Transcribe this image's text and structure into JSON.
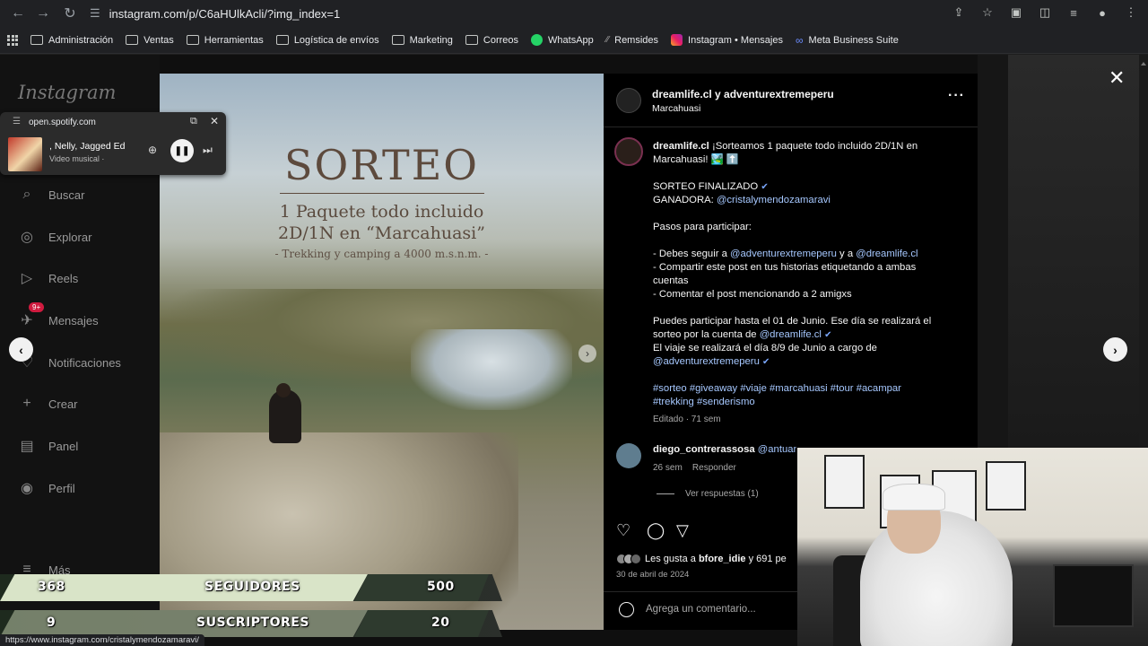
{
  "browser": {
    "url": "instagram.com/p/C6aHUlkAcli/?img_index=1",
    "status_url": "https://www.instagram.com/cristalymendozamaravi/"
  },
  "bookmarks": [
    {
      "label": "Administración",
      "icon": "folder-icon"
    },
    {
      "label": "Ventas",
      "icon": "folder-icon"
    },
    {
      "label": "Herramientas",
      "icon": "folder-icon"
    },
    {
      "label": "Logística de envíos",
      "icon": "folder-icon"
    },
    {
      "label": "Marketing",
      "icon": "folder-icon"
    },
    {
      "label": "Correos",
      "icon": "folder-icon"
    },
    {
      "label": "WhatsApp",
      "icon": "whatsapp-icon"
    },
    {
      "label": "Remsides",
      "icon": "remsides-icon"
    },
    {
      "label": "Instagram • Mensajes",
      "icon": "instagram-icon"
    },
    {
      "label": "Meta Business Suite",
      "icon": "meta-icon"
    }
  ],
  "sidebar": {
    "logo": "Instagram",
    "items": [
      {
        "label": "Buscar",
        "icon": "search-icon"
      },
      {
        "label": "Explorar",
        "icon": "compass-icon"
      },
      {
        "label": "Reels",
        "icon": "reels-icon"
      },
      {
        "label": "Mensajes",
        "icon": "messenger-icon",
        "badge": "9+"
      },
      {
        "label": "Notificaciones",
        "icon": "heart-icon"
      },
      {
        "label": "Crear",
        "icon": "plus-icon"
      },
      {
        "label": "Panel",
        "icon": "dashboard-icon"
      },
      {
        "label": "Perfil",
        "icon": "profile-icon"
      },
      {
        "label": "Más",
        "icon": "menu-icon"
      }
    ]
  },
  "spotify": {
    "url": "open.spotify.com",
    "title": ", Nelly, Jagged Ed",
    "subtitle": "Video musical ·"
  },
  "post_image": {
    "title": "SORTEO",
    "line1": "1 Paquete todo incluido",
    "line2": "2D/1N en “Marcahuasi”",
    "line3": "- Trekking y camping a 4000 m.s.n.m. -"
  },
  "post": {
    "header_user": "dreamlife.cl y adventurextremeperu",
    "header_location": "Marcahuasi",
    "caption_user": "dreamlife.cl",
    "caption_intro": "¡Sorteamos 1 paquete todo incluido 2D/1N en Marcahuasi! 🏞️ ⬆️",
    "line_finalizado": "SORTEO FINALIZADO",
    "winner_label": "GANADORA:",
    "winner_handle": "@cristalymendozamaravi",
    "steps_title": "Pasos para participar:",
    "step1_a": "- Debes seguir a",
    "step1_handle1": "@adventurextremeperu",
    "step1_and": "y a",
    "step1_handle2": "@dreamlife.cl",
    "step2": "- Compartir este post en tus historias etiquetando a ambas cuentas",
    "step3": "- Comentar el post mencionando a 2 amigxs",
    "deadline_a": "Puedes participar hasta el 01 de Junio. Ese día se realizará el sorteo por la cuenta de",
    "deadline_handle": "@dreamlife.cl",
    "trip_a": "El viaje se realizará el día 8/9 de Junio a cargo de",
    "trip_handle": "@adventurextremeperu",
    "hashtags": "#sorteo #giveaway #viaje #marcahuasi #tour #acampar #trekking #senderismo",
    "edited": "Editado · 71 sem",
    "comment_user": "diego_contrerassosa",
    "comment_text": "@antuanetma @ponesiguehumberto",
    "comment_time": "26 sem",
    "comment_reply": "Responder",
    "view_replies": "Ver respuestas (1)",
    "likes_prefix": "Les gusta a",
    "likes_user": "bfore_idie",
    "likes_suffix": "y 691 pe",
    "date": "30 de abril de 2024",
    "add_comment_placeholder": "Agrega un comentario..."
  },
  "stats": {
    "followers_current": "368",
    "followers_label": "SEGUIDORES",
    "followers_goal": "500",
    "subs_current": "9",
    "subs_label": "SUSCRIPTORES",
    "subs_goal": "20"
  }
}
